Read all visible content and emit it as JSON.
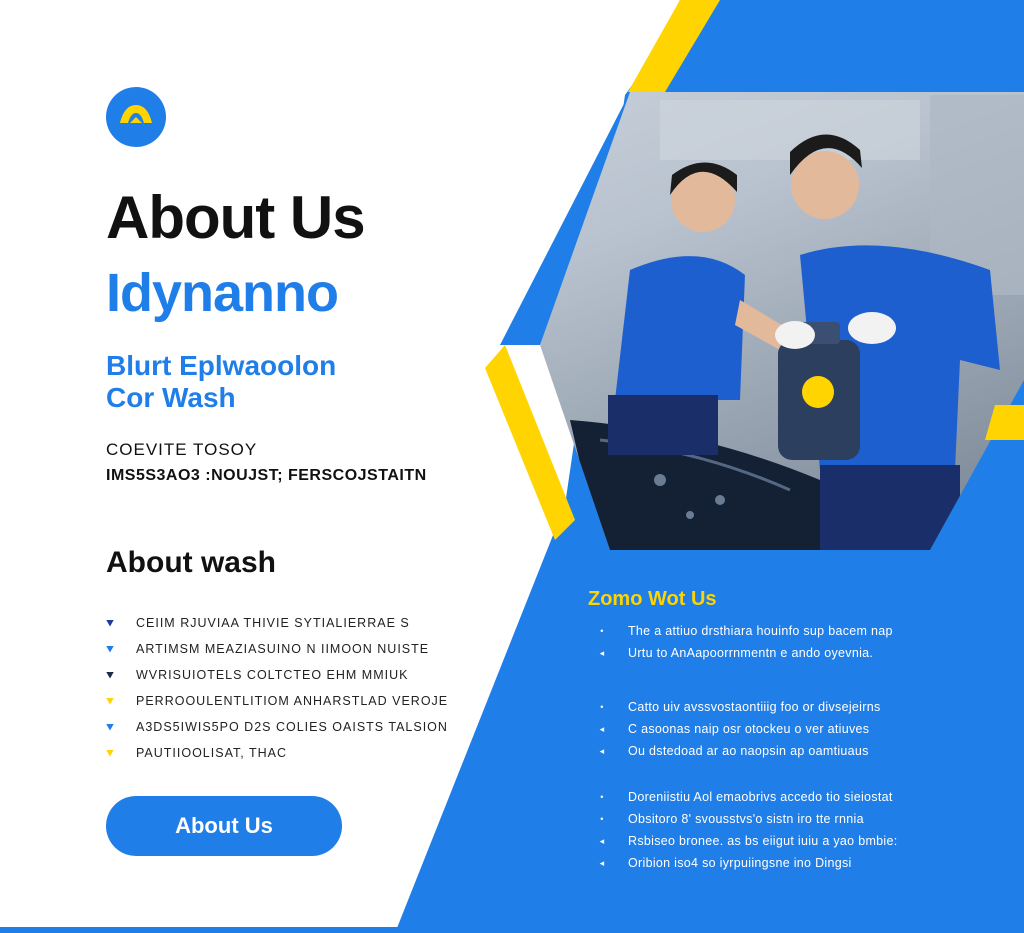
{
  "header": {
    "title": "About Us",
    "brand": "Idynanno",
    "tagline_line1": "Blurt Eplwaoolon",
    "tagline_line2": "Cor Wash"
  },
  "contact": {
    "label": "COEVITE TOSOY",
    "info": "IMS5S3AO3 :NOUJST; FERSCOJSTAITN"
  },
  "left_section": {
    "title": "About wash",
    "items": [
      {
        "text": "CEIIM RJUVIAA THIVIE SYTIALIERRAE S",
        "color": "#1f3b9e"
      },
      {
        "text": "ARTIMSM MEAZIASUINO N IIMOON NUISTE",
        "color": "#1f7ee8"
      },
      {
        "text": "WVRISUIOTELS COLTCTEO EHM MMIUK",
        "color": "#1a2a4a"
      },
      {
        "text": "PERROOULENTLITIOM ANHARSTLAD VEROJE",
        "color": "#ffd400"
      },
      {
        "text": "A3DS5IWIS5PO D2S COLIES OAISTS TALSION",
        "color": "#1f7ee8"
      },
      {
        "text": "PAUTIIOOLISAT, THAC",
        "color": "#ffd400"
      }
    ],
    "button_label": "About Us"
  },
  "right_section": {
    "title": "Zomo Wot Us",
    "group1": [
      {
        "bullet": "•",
        "text": "The a attiuo drsthiara houinfo sup bacem nap"
      },
      {
        "bullet": "◂",
        "text": "Urtu to AnAapoorrnmentn e ando oyevnia."
      }
    ],
    "group2": [
      {
        "bullet": "•",
        "text": "Catto uiv avssvostaontiiig foo or divsejeirns"
      },
      {
        "bullet": "◂",
        "text": "C asoonas naip osr otockeu  o  ver atiuves"
      },
      {
        "bullet": "◂",
        "text": "Ou dstedoad ar ao naopsin ap oamtiuaus"
      }
    ],
    "group3": [
      {
        "bullet": "•",
        "text": "Doreniistiu Aol emaobrivs accedo tio sieiostat"
      },
      {
        "bullet": "•",
        "text": "Obsitoro 8' svousstvs'o sistn iro tte rnnia"
      },
      {
        "bullet": "◂",
        "text": "Rsbiseo bronee. as bs eiigut  iuiu a yao bmbie:"
      },
      {
        "bullet": "◂",
        "text": "Oribion iso4 so  iyrpuiingsne ino Dingsi"
      }
    ]
  },
  "colors": {
    "primary_blue": "#1f7ee8",
    "accent_yellow": "#ffd400",
    "text_dark": "#111111"
  }
}
